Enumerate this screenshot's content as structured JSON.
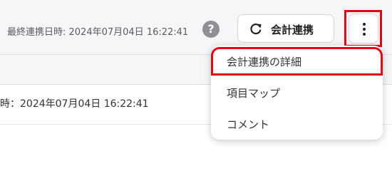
{
  "header": {
    "last_sync_label": "最終連携日時: 2024年07月04日 16:22:41",
    "help_icon": "question-circle-icon",
    "sync_button_label": "会計連携",
    "sync_icon": "refresh-icon",
    "more_icon": "vertical-ellipsis-icon"
  },
  "content": {
    "sync_datetime_text": "時：2024年07月04日 16:22:41"
  },
  "menu": {
    "items": [
      {
        "label": "会計連携の詳細",
        "highlighted": true
      },
      {
        "label": "項目マップ",
        "highlighted": false
      },
      {
        "label": "コメント",
        "highlighted": false
      }
    ]
  },
  "colors": {
    "highlight": "#e60012",
    "toolbar_bg": "#f5f6f7",
    "help_icon_bg": "#8e9095"
  }
}
